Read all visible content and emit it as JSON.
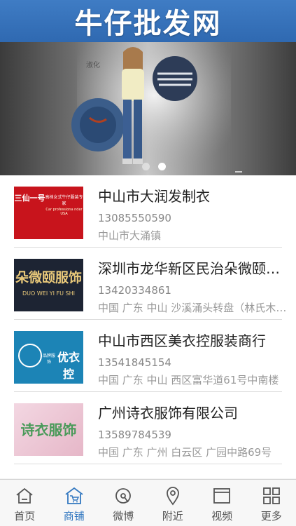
{
  "header": {
    "title": "牛仔批发网"
  },
  "banner": {
    "logo_text": "淑化",
    "dots": 2,
    "active_dot": 1
  },
  "listings": [
    {
      "name": "中山市大润发制衣",
      "phone": "13085550590",
      "address": "中山市大涌镇",
      "thumb": {
        "brand": "三仙一号",
        "line1": "高档女式牛仔服装专家",
        "line2": "Car professiona nder USA"
      }
    },
    {
      "name": "深圳市龙华新区民治朵微颐服饰",
      "phone": "13420334861",
      "address": "中国 广东 中山 沙溪涌头转盘（林氏木业后面）",
      "thumb": {
        "brand": "朵微颐服饰",
        "line1": "DUO WEI YI FU SHI"
      }
    },
    {
      "name": "中山市西区美衣控服装商行",
      "phone": "13541845154",
      "address": "中国 广东 中山 西区富华道61号中南楼",
      "thumb": {
        "brand": "优衣控",
        "line1": "品牌服饰"
      }
    },
    {
      "name": "广州诗衣服饰有限公司",
      "phone": "13589784539",
      "address": "中国 广东 广州 白云区 广园中路69号",
      "thumb": {
        "brand": "诗衣服饰"
      }
    }
  ],
  "tabbar": {
    "active": "商铺",
    "items": [
      {
        "label": "首页",
        "icon": "home-icon"
      },
      {
        "label": "商铺",
        "icon": "shop-icon"
      },
      {
        "label": "微博",
        "icon": "weibo-icon"
      },
      {
        "label": "附近",
        "icon": "location-icon"
      },
      {
        "label": "视频",
        "icon": "video-icon"
      },
      {
        "label": "更多",
        "icon": "grid-icon"
      }
    ]
  },
  "colors": {
    "header": "#3373bb",
    "active_tab": "#3378c0",
    "divider": "#dcdcdc"
  }
}
